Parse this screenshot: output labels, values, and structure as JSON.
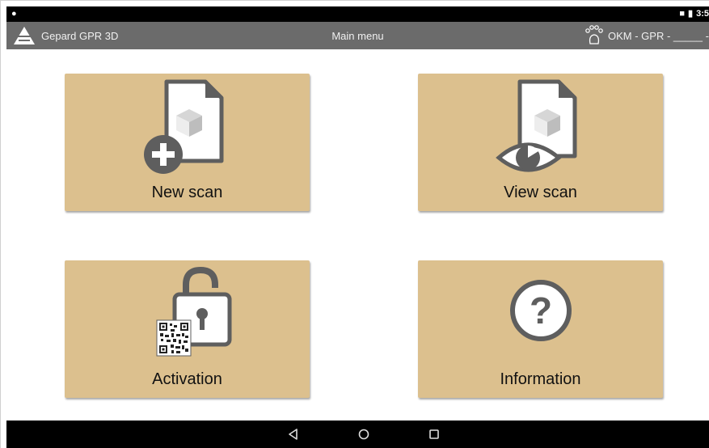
{
  "status_bar": {
    "left_icon": "android-debug-icon",
    "right_icons": [
      "lock-icon",
      "battery-icon"
    ],
    "time": "3:5"
  },
  "app_bar": {
    "app_name": "Gepard GPR 3D",
    "screen_title": "Main menu",
    "device_label": "OKM - GPR - _____ -",
    "logo_icon": "gepard-logo-icon",
    "device_icon": "paw-icon"
  },
  "menu": {
    "tiles": [
      {
        "label": "New scan",
        "icon": "new-document-icon"
      },
      {
        "label": "View scan",
        "icon": "view-document-icon"
      },
      {
        "label": "Activation",
        "icon": "unlock-qr-icon"
      },
      {
        "label": "Information",
        "icon": "question-icon"
      }
    ]
  },
  "nav_bar": {
    "back_icon": "back-triangle-icon",
    "home_icon": "home-circle-icon",
    "recents_icon": "recents-square-icon"
  },
  "colors": {
    "tile_background": "#dcc08e",
    "app_bar": "#6b6b6b",
    "icon_gray": "#5e5e5e"
  }
}
